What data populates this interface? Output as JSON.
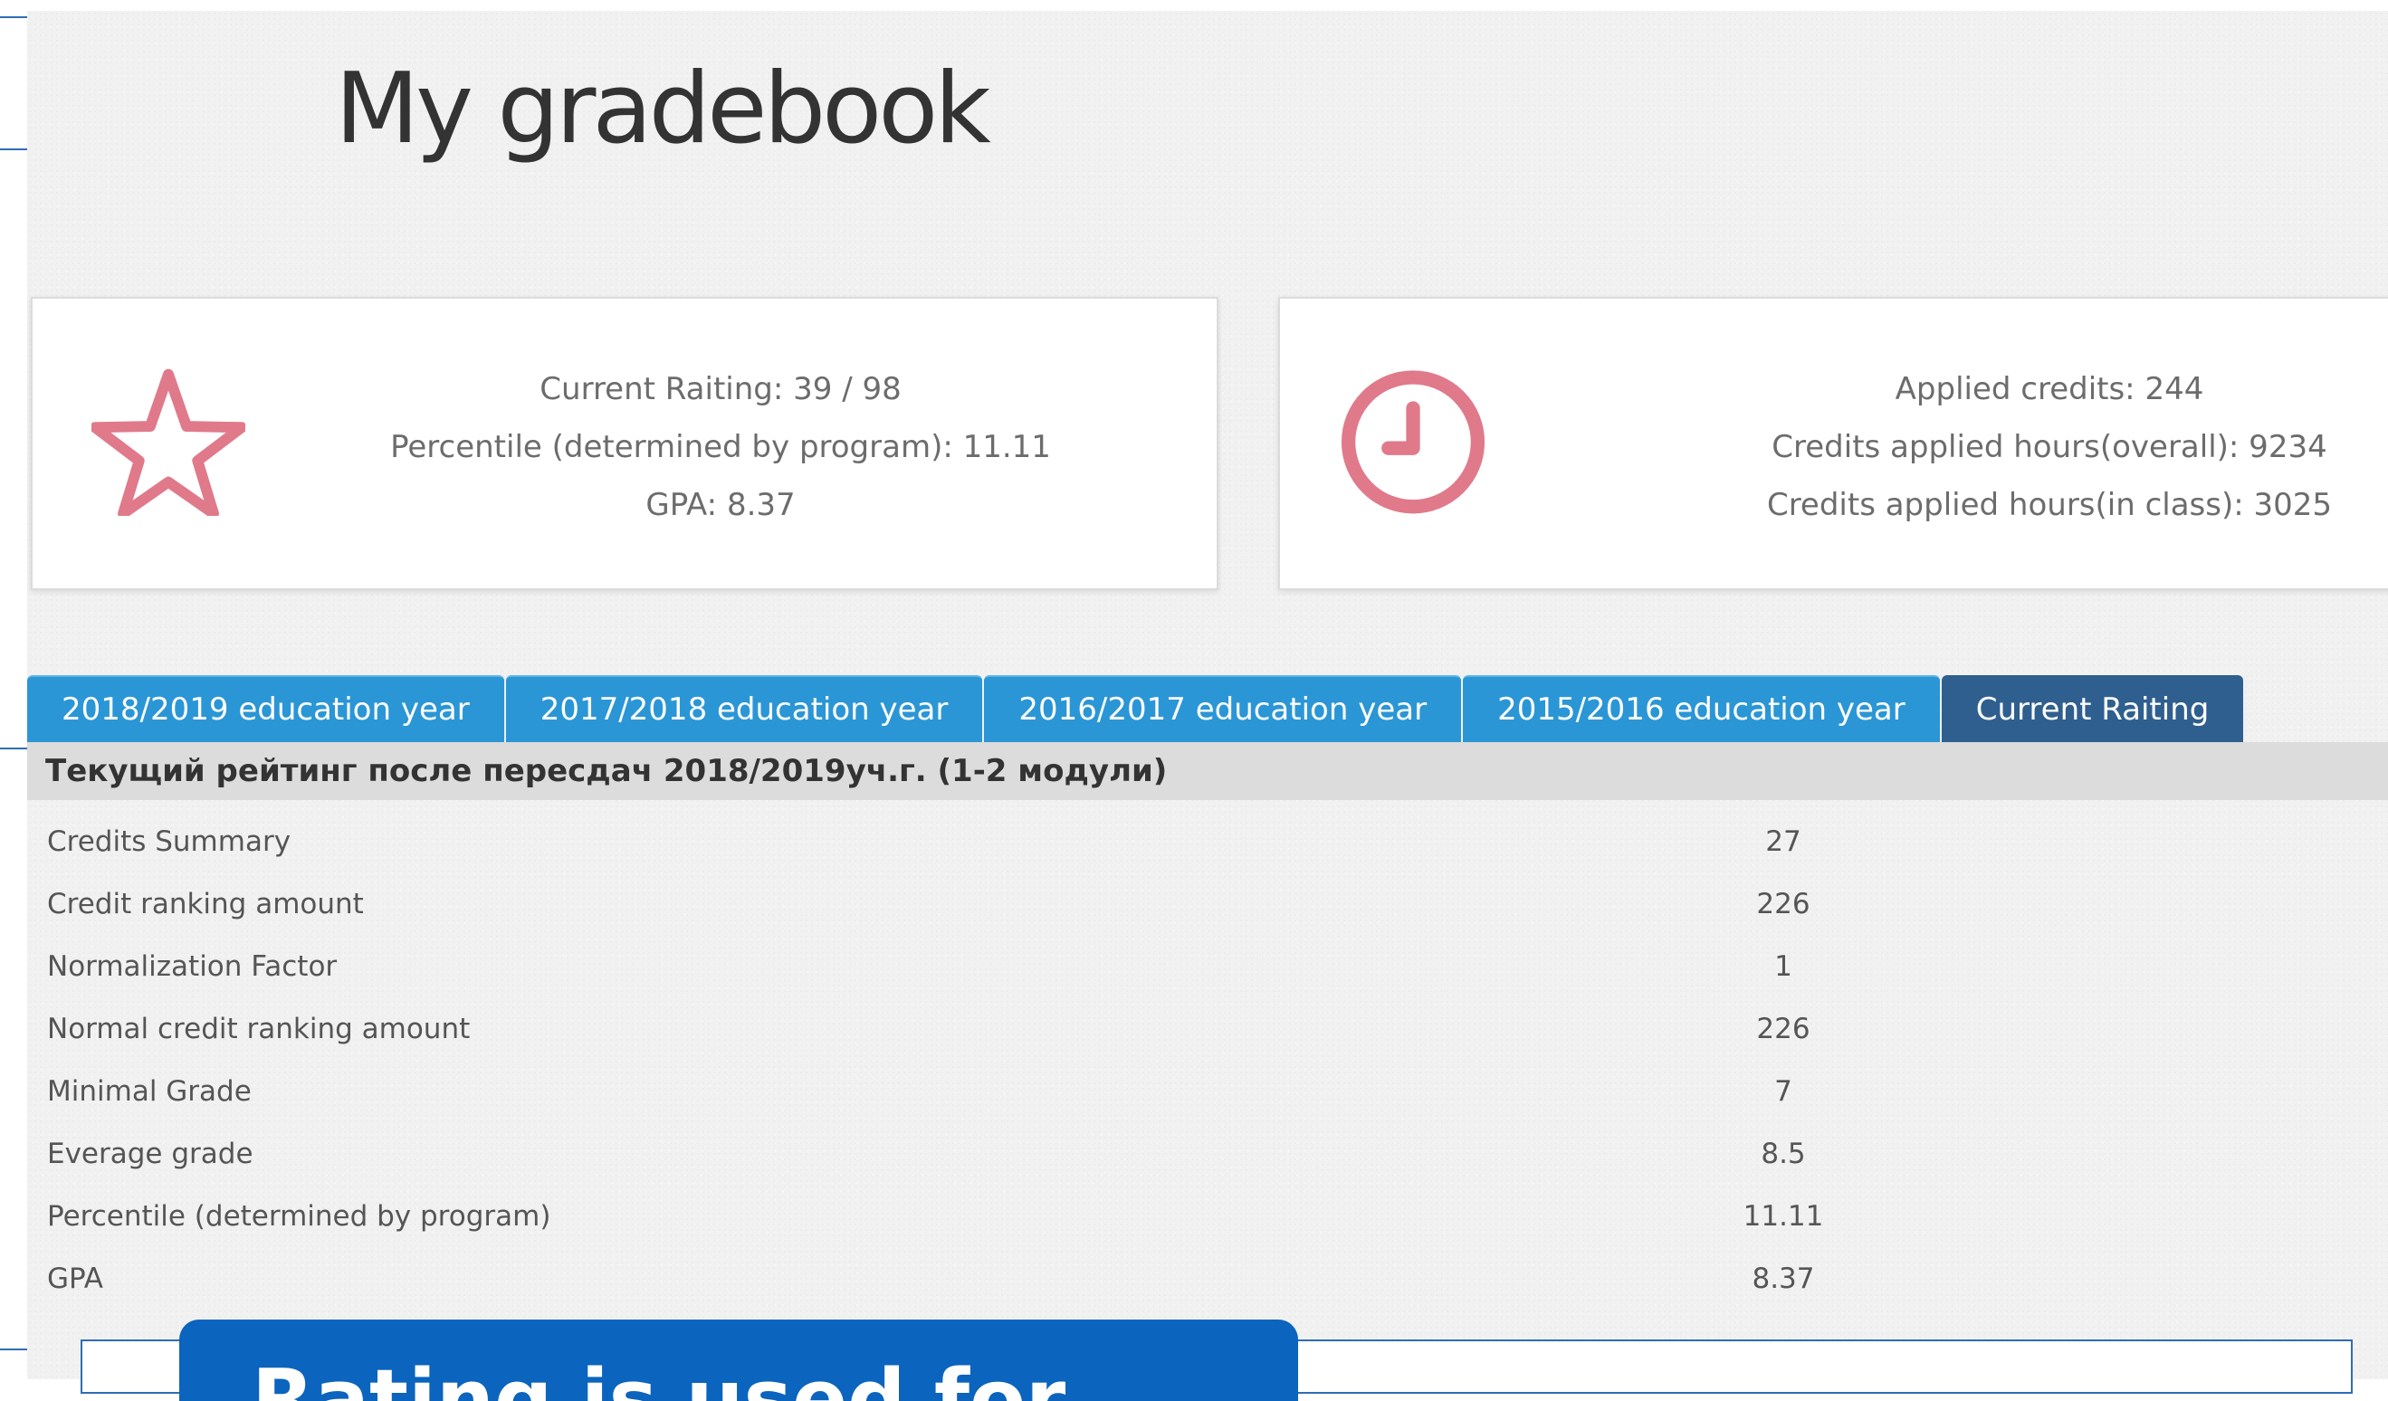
{
  "page": {
    "title": "My gradebook"
  },
  "rating_card": {
    "icon": "star-icon",
    "current_rating": "Current Raiting: 39 / 98",
    "percentile": "Percentile (determined by program): 11.11",
    "gpa": "GPA: 8.37"
  },
  "credits_card": {
    "icon": "clock-icon",
    "applied_credits": "Applied credits: 244",
    "hours_overall": "Credits applied hours(overall): 9234",
    "hours_in_class": "Credits applied hours(in class): 3025"
  },
  "tabs": [
    {
      "label": "2018/2019 education year",
      "active": false
    },
    {
      "label": "2017/2018 education year",
      "active": false
    },
    {
      "label": "2016/2017 education year",
      "active": false
    },
    {
      "label": "2015/2016 education year",
      "active": false
    },
    {
      "label": "Current Raiting",
      "active": true
    }
  ],
  "section": {
    "header": "Текущий рейтинг после пересдач 2018/2019уч.г. (1-2 модули)"
  },
  "rows": [
    {
      "label": "Credits Summary",
      "value": "27"
    },
    {
      "label": "Credit ranking amount",
      "value": "226"
    },
    {
      "label": "Normalization Factor",
      "value": "1"
    },
    {
      "label": "Normal credit ranking amount",
      "value": "226"
    },
    {
      "label": "Minimal Grade",
      "value": "7"
    },
    {
      "label": "Everage grade",
      "value": "8.5"
    },
    {
      "label": "Percentile (determined by program)",
      "value": "11.11"
    },
    {
      "label": "GPA",
      "value": "8.37"
    }
  ],
  "overlay": {
    "text": "Rating is used for..."
  },
  "colors": {
    "tab": "#2b96d6",
    "tab_active": "#2f5f8f",
    "icon_pink": "#e07a8a",
    "overlay_blue": "#0b64bd"
  }
}
